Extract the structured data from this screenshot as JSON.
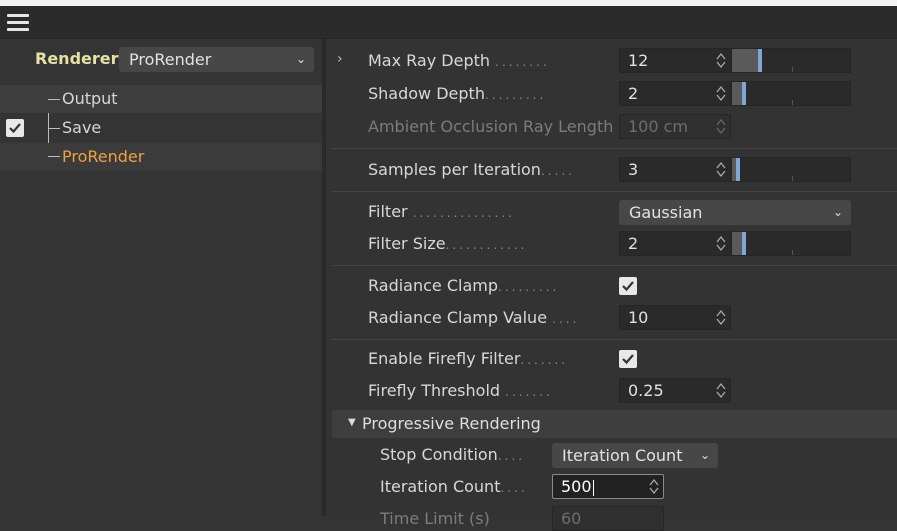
{
  "menu": {
    "icon": "hamburger-menu-icon"
  },
  "left_panel": {
    "renderer_label": "Renderer",
    "renderer_select": "ProRender",
    "tree": [
      {
        "label": "Output",
        "checked": false
      },
      {
        "label": "Save",
        "checked": true
      },
      {
        "label": "ProRender",
        "checked": false,
        "selected": true
      }
    ]
  },
  "properties": {
    "max_ray_depth": {
      "label": "Max Ray Depth",
      "value": "12",
      "slider_fraction": 0.25
    },
    "shadow_depth": {
      "label": "Shadow Depth",
      "value": "2",
      "slider_fraction": 0.1
    },
    "ambient_occlusion": {
      "label": "Ambient Occlusion Ray Length",
      "value": "100 cm"
    },
    "samples_per_iteration": {
      "label": "Samples per Iteration",
      "value": "3",
      "slider_fraction": 0.06
    },
    "filter": {
      "label": "Filter",
      "value": "Gaussian"
    },
    "filter_size": {
      "label": "Filter Size",
      "value": "2",
      "slider_fraction": 0.1
    },
    "radiance_clamp": {
      "label": "Radiance Clamp",
      "checked": true
    },
    "radiance_clamp_value": {
      "label": "Radiance Clamp Value",
      "value": "10"
    },
    "enable_firefly": {
      "label": "Enable Firefly Filter",
      "checked": true
    },
    "firefly_threshold": {
      "label": "Firefly Threshold",
      "value": "0.25"
    }
  },
  "progressive": {
    "title": "Progressive Rendering",
    "stop_condition": {
      "label": "Stop Condition",
      "value": "Iteration Count"
    },
    "iteration_count": {
      "label": "Iteration Count",
      "value": "500"
    },
    "time_limit": {
      "label": "Time Limit (s)",
      "value": "60"
    }
  },
  "colors": {
    "accent_orange": "#f0a040",
    "renderer_label": "#e8e1a6",
    "slider_knob": "#7fa7d6"
  }
}
